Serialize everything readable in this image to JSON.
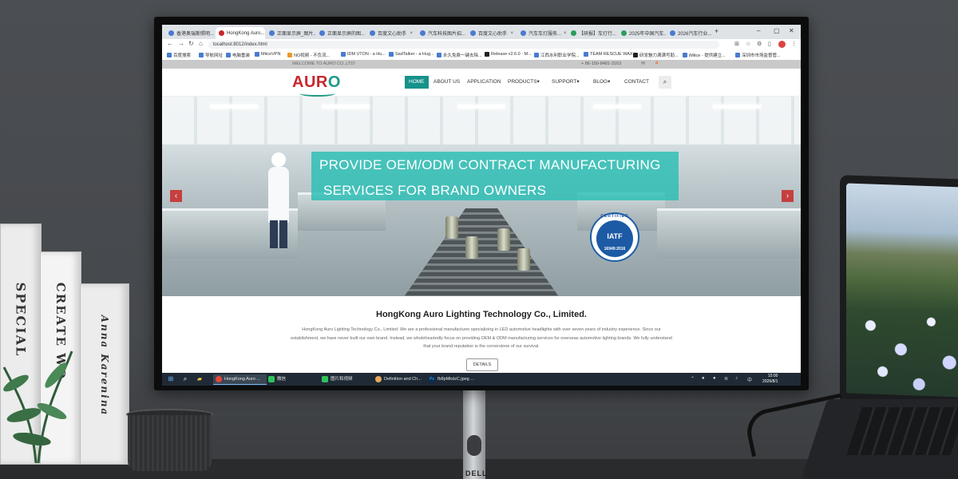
{
  "scene": {
    "books": [
      "SPECIAL",
      "CREATE WO",
      "Anna Karenina"
    ],
    "monitor_brand": "DELL"
  },
  "browser": {
    "tabs": [
      {
        "label": "香港奥瑞斯照明...",
        "active": false
      },
      {
        "label": "HongKong Auro...",
        "active": true
      },
      {
        "label": "正面显示屏_图片...",
        "active": false
      },
      {
        "label": "正面显示屏的图...",
        "active": false
      },
      {
        "label": "百度文心助手",
        "active": false
      },
      {
        "label": "汽车科技图片招...",
        "active": false
      },
      {
        "label": "百度文心助手",
        "active": false
      },
      {
        "label": "汽车车灯服务...",
        "active": false
      },
      {
        "label": "【研报】车灯行...",
        "active": false
      },
      {
        "label": "2025年中国汽车...",
        "active": false
      },
      {
        "label": "2026汽车行业...",
        "active": false
      }
    ],
    "url": "localhost:8012/index.html",
    "bookmarks": [
      "百度搜索",
      "导航网址",
      "电脑重装",
      "MitceVPN",
      "NO视频 - 不负流...",
      "IDM VTON - a Hu...",
      "SadTalker - a Hug...",
      "永久免费一键去除...",
      "Release v2.6.0 · M...",
      "江西水利职业学院...",
      "TEAM RESCUE WAX",
      "研发魅力满满号助...",
      "iMitce - 提供建立...",
      "深圳市市场监督管..."
    ]
  },
  "site": {
    "welcome": "WELCOME TO AURO CO.,LTD!",
    "phone": "+ 86-150-8481-3163",
    "logo": {
      "main": "AUR",
      "accent": "O"
    },
    "nav": [
      "HOME",
      "ABOUT US",
      "APPLICATION",
      "PRODUCTS",
      "SUPPORT",
      "BLOG",
      "CONTACT"
    ],
    "hero": {
      "line1": "PROVIDE OEM/ODM CONTRACT MANUFACTURING",
      "line2": "SERVICES FOR BRAND OWNERS",
      "badge": {
        "top": "CERTIFIED",
        "name": "IATF",
        "number": "16949:2016"
      },
      "prev": "‹",
      "next": "›"
    },
    "about": {
      "title": "HongKong Auro Lighting Technology Co., Limited.",
      "text": "HongKong Auro Lighting Technology Co., Limited. We are a professional manufacturer specializing in LED automotive headlights with over seven years of industry experience. Since our establishment, we have never built our own brand. Instead, we wholeheartedly focus on providing OEM & ODM manufacturing services for overseas automotive lighting brands. We fully understand that your brand reputation is the cornerstone of our survival.",
      "button": "DETAILS"
    }
  },
  "taskbar": {
    "apps": [
      "HongKong Auro ...",
      "微信",
      "图片和视频",
      "Definition and Ch...",
      "fb8pMkdzC.jpeg ..."
    ],
    "time": "15:00",
    "date": "2026/8/1"
  },
  "colors": {
    "accent": "#16928a",
    "brand_red": "#c8262c",
    "banner": "#2abeb4"
  }
}
